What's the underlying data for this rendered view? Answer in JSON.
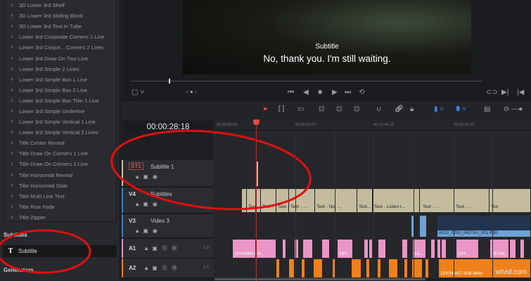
{
  "effects_list": [
    "3D Lower 3rd Shelf",
    "3D Lower 3rd Sliding Block",
    "3D Lower 3rd Text In Tube",
    "Lower 3rd Corporate Corners 1 Line",
    "Lower 3rd Corpor... Corners 2 Lines",
    "Lower 3rd Draw On Two Line",
    "Lower 3rd Simple 2 Lines",
    "Lower 3rd Simple Box 1 Line",
    "Lower 3rd Simple Box 2 Line",
    "Lower 3rd Simple Box Thin 1 Line",
    "Lower 3rd Simple Underline",
    "Lower 3rd Simple Vertical 1 Line",
    "Lower 3rd Simple Vertical 2 Lines",
    "Title Center Reveal",
    "Title Draw On Corners 1 Line",
    "Title Draw On Corners 2 Line",
    "Title Horizontal Reveal",
    "Title Horizontal Slide",
    "Title Multi Line Text",
    "Title Rise Fade",
    "Title Zipper"
  ],
  "subtitles_section": {
    "header": "Subtitles",
    "item": "Subtitle"
  },
  "generators_header": "Generators",
  "viewer": {
    "subtitle_title": "Subtitle",
    "subtitle_text": "No, thank you. I'm still waiting."
  },
  "timecode": "00:00:28:18",
  "ruler": [
    "00:00:00:00",
    "00:00:52:07",
    "00:01:44:15",
    "00:02:36:22"
  ],
  "tracks": [
    {
      "id": "ST1",
      "name": "Subtitle 1",
      "color": "#c9c0a5"
    },
    {
      "id": "V4",
      "name": "Subtitles",
      "color": "#3f7fbf"
    },
    {
      "id": "V3",
      "name": "Video 3",
      "color": "#3f7fbf"
    },
    {
      "id": "A1",
      "name": "",
      "volume": "1.0",
      "color": "#e58fc3"
    },
    {
      "id": "A2",
      "name": "",
      "volume": "1.0",
      "color": "#ef7f1a"
    }
  ],
  "v4_clip_labels": [
    "Text -",
    "Text -",
    "Text -",
    "Text - ...",
    "Text - No, ...",
    "Text...",
    "Text - Listen t...",
    "Text - ...",
    "Text - ...",
    "Tex"
  ],
  "v3_clip_label": "A013_C030_0427AU_001.R3D",
  "a1_clip_labels": [
    "15Y04M27-0...",
    "15Y...",
    "15...",
    "15Y...",
    "15Y04..."
  ],
  "a2_clip_label": "15Y04M27-006.WAV",
  "watermark": "wtvid.com",
  "colors": {
    "subtitle_clip": "#c5bc9f",
    "video_clip": "#6ea2d6",
    "audio1_clip": "#e996c6",
    "audio2_clip": "#f0801a",
    "annotation": "#e01010",
    "playhead": "#e24a4a"
  }
}
